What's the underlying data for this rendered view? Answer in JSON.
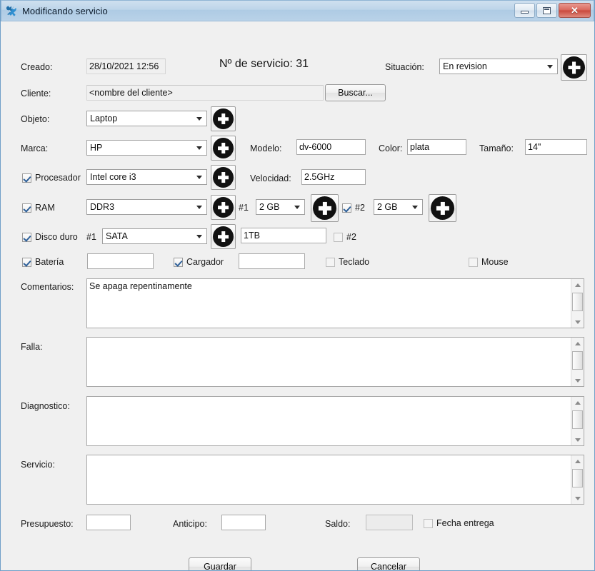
{
  "window": {
    "title": "Modificando servicio",
    "icon": "tools-icon",
    "buttons": {
      "minimize": "minimize-icon",
      "maximize": "maximize-icon",
      "close": "✕"
    },
    "accent_titlebar": "#b4cde4",
    "accent_body": "#f0f0f0"
  },
  "form": {
    "creado": {
      "label": "Creado:",
      "value": "28/10/2021 12:56"
    },
    "servicio_num": {
      "text": "Nº de servicio: 31"
    },
    "situacion": {
      "label": "Situación:",
      "value": "En revision",
      "add": "+"
    },
    "cliente": {
      "label": "Cliente:",
      "value": "<nombre del cliente>",
      "search_button": "Buscar..."
    },
    "objeto": {
      "label": "Objeto:",
      "value": "Laptop",
      "add": "+"
    },
    "marca": {
      "label": "Marca:",
      "value": "HP",
      "add": "+"
    },
    "modelo": {
      "label": "Modelo:",
      "value": "dv-6000"
    },
    "color": {
      "label": "Color:",
      "value": "plata"
    },
    "tamano": {
      "label": "Tamaño:",
      "value": "14\""
    },
    "procesador": {
      "label": "Procesador",
      "checked": true,
      "value": "Intel core i3",
      "add": "+"
    },
    "velocidad": {
      "label": "Velocidad:",
      "value": "2.5GHz"
    },
    "ram": {
      "label": "RAM",
      "checked": true,
      "type": "DDR3",
      "add": "+",
      "slot1": {
        "label": "#1",
        "value": "2 GB",
        "add": "+"
      },
      "slot2": {
        "label": "#2",
        "checked": true,
        "value": "2 GB",
        "add": "+"
      }
    },
    "disco": {
      "label": "Disco duro",
      "checked": true,
      "slot1_label": "#1",
      "type": "SATA",
      "add": "+",
      "capacity": "1TB",
      "slot2": {
        "label": "#2",
        "checked": false
      }
    },
    "accesorios": {
      "bateria": {
        "label": "Batería",
        "checked": true,
        "value": ""
      },
      "cargador": {
        "label": "Cargador",
        "checked": true,
        "value": ""
      },
      "teclado": {
        "label": "Teclado",
        "checked": false
      },
      "mouse": {
        "label": "Mouse",
        "checked": false
      }
    },
    "comentarios": {
      "label": "Comentarios:",
      "value": "Se apaga repentinamente"
    },
    "falla": {
      "label": "Falla:",
      "value": ""
    },
    "diagnostico": {
      "label": "Diagnostico:",
      "value": ""
    },
    "servicio": {
      "label": "Servicio:",
      "value": ""
    },
    "presupuesto": {
      "label": "Presupuesto:",
      "value": ""
    },
    "anticipo": {
      "label": "Anticipo:",
      "value": ""
    },
    "saldo": {
      "label": "Saldo:",
      "value": ""
    },
    "fecha_entrega": {
      "label": "Fecha entrega",
      "checked": false
    }
  },
  "actions": {
    "guardar": "Guardar",
    "cancelar": "Cancelar"
  }
}
